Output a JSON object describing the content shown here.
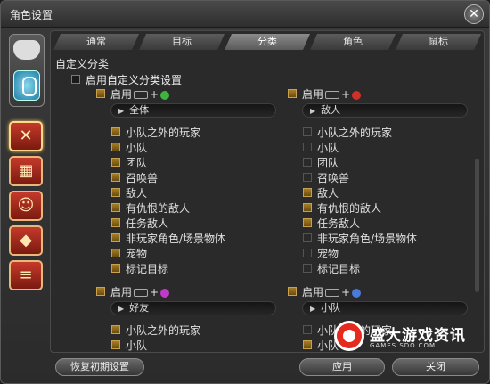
{
  "window": {
    "title": "角色设置",
    "close_symbol": "✕"
  },
  "sidebar": {
    "top_icons": [
      "gamepad-icon",
      "mouse-icon"
    ],
    "buttons": [
      {
        "icon": "target-cross-icon",
        "glyph": "✕",
        "active": true
      },
      {
        "icon": "card-icon",
        "glyph": "▦",
        "active": false
      },
      {
        "icon": "person-card-icon",
        "glyph": "☺",
        "active": false
      },
      {
        "icon": "tiles-icon",
        "glyph": "◆",
        "active": false
      },
      {
        "icon": "chat-icon",
        "glyph": "≡",
        "active": false
      }
    ]
  },
  "tabs": [
    "通常",
    "目标",
    "分类",
    "角色",
    "鼠标"
  ],
  "active_tab": "分类",
  "section": {
    "title": "自定义分类",
    "main_toggle": "启用自定义分类设置",
    "enable_label": "启用",
    "plus": "+"
  },
  "groups": [
    {
      "id": "g1",
      "button_color": "#3fb23f",
      "dropdown": "全体",
      "items": [
        {
          "label": "小队之外的玩家",
          "checked": true
        },
        {
          "label": "小队",
          "checked": true
        },
        {
          "label": "团队",
          "checked": true
        },
        {
          "label": "召唤兽",
          "checked": true
        },
        {
          "label": "敌人",
          "checked": true
        },
        {
          "label": "有仇恨的敌人",
          "checked": true
        },
        {
          "label": "任务敌人",
          "checked": true
        },
        {
          "label": "非玩家角色/场景物体",
          "checked": true
        },
        {
          "label": "宠物",
          "checked": true
        },
        {
          "label": "标记目标",
          "checked": true
        }
      ]
    },
    {
      "id": "g2",
      "button_color": "#d0302a",
      "dropdown": "敌人",
      "items": [
        {
          "label": "小队之外的玩家",
          "checked": false
        },
        {
          "label": "小队",
          "checked": false
        },
        {
          "label": "团队",
          "checked": false
        },
        {
          "label": "召唤兽",
          "checked": false
        },
        {
          "label": "敌人",
          "checked": true
        },
        {
          "label": "有仇恨的敌人",
          "checked": true
        },
        {
          "label": "任务敌人",
          "checked": true
        },
        {
          "label": "非玩家角色/场景物体",
          "checked": false
        },
        {
          "label": "宠物",
          "checked": false
        },
        {
          "label": "标记目标",
          "checked": false
        }
      ]
    },
    {
      "id": "g3",
      "button_color": "#c03ac8",
      "dropdown": "好友",
      "items": [
        {
          "label": "小队之外的玩家",
          "checked": true
        },
        {
          "label": "小队",
          "checked": true
        }
      ]
    },
    {
      "id": "g4",
      "button_color": "#4a7ad8",
      "dropdown": "小队",
      "items": [
        {
          "label": "小队之外的玩家",
          "checked": false
        },
        {
          "label": "小队",
          "checked": true
        }
      ]
    }
  ],
  "footer": {
    "reset": "恢复初期设置",
    "apply": "应用",
    "close": "关闭"
  },
  "watermark": {
    "title": "盛大游戏资讯",
    "subtitle": "GAMES.SDO.COM"
  }
}
